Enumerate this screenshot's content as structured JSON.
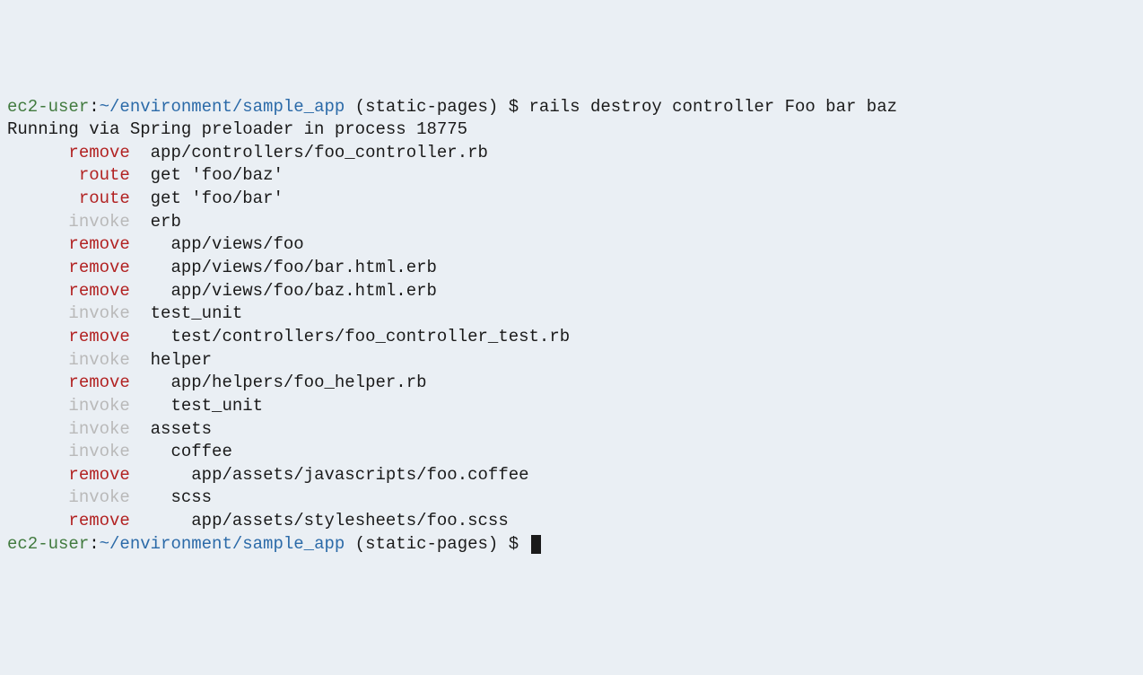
{
  "prompt1": {
    "user": "ec2-user",
    "colon": ":",
    "path": "~/environment/sample_app",
    "branch": " (static-pages) ",
    "dollar": "$ ",
    "command": "rails destroy controller Foo bar baz"
  },
  "preloader": "Running via Spring preloader in process 18775",
  "rows": [
    {
      "action": "remove",
      "klass": "action-remove",
      "pad": "      ",
      "arg": "app/controllers/foo_controller.rb",
      "argpad": "  "
    },
    {
      "action": "route",
      "klass": "action-route",
      "pad": "       ",
      "arg": "get 'foo/baz'",
      "argpad": "  "
    },
    {
      "action": "route",
      "klass": "action-route",
      "pad": "       ",
      "arg": "get 'foo/bar'",
      "argpad": "  "
    },
    {
      "action": "invoke",
      "klass": "action-invoke",
      "pad": "      ",
      "arg": "erb",
      "argpad": "  "
    },
    {
      "action": "remove",
      "klass": "action-remove",
      "pad": "      ",
      "arg": "app/views/foo",
      "argpad": "    "
    },
    {
      "action": "remove",
      "klass": "action-remove",
      "pad": "      ",
      "arg": "app/views/foo/bar.html.erb",
      "argpad": "    "
    },
    {
      "action": "remove",
      "klass": "action-remove",
      "pad": "      ",
      "arg": "app/views/foo/baz.html.erb",
      "argpad": "    "
    },
    {
      "action": "invoke",
      "klass": "action-invoke",
      "pad": "      ",
      "arg": "test_unit",
      "argpad": "  "
    },
    {
      "action": "remove",
      "klass": "action-remove",
      "pad": "      ",
      "arg": "test/controllers/foo_controller_test.rb",
      "argpad": "    "
    },
    {
      "action": "invoke",
      "klass": "action-invoke",
      "pad": "      ",
      "arg": "helper",
      "argpad": "  "
    },
    {
      "action": "remove",
      "klass": "action-remove",
      "pad": "      ",
      "arg": "app/helpers/foo_helper.rb",
      "argpad": "    "
    },
    {
      "action": "invoke",
      "klass": "action-invoke",
      "pad": "      ",
      "arg": "test_unit",
      "argpad": "    "
    },
    {
      "action": "invoke",
      "klass": "action-invoke",
      "pad": "      ",
      "arg": "assets",
      "argpad": "  "
    },
    {
      "action": "invoke",
      "klass": "action-invoke",
      "pad": "      ",
      "arg": "coffee",
      "argpad": "    "
    },
    {
      "action": "remove",
      "klass": "action-remove",
      "pad": "      ",
      "arg": "app/assets/javascripts/foo.coffee",
      "argpad": "      "
    },
    {
      "action": "invoke",
      "klass": "action-invoke",
      "pad": "      ",
      "arg": "scss",
      "argpad": "    "
    },
    {
      "action": "remove",
      "klass": "action-remove",
      "pad": "      ",
      "arg": "app/assets/stylesheets/foo.scss",
      "argpad": "      "
    }
  ],
  "prompt2": {
    "user": "ec2-user",
    "colon": ":",
    "path": "~/environment/sample_app",
    "branch": " (static-pages) ",
    "dollar": "$ "
  }
}
